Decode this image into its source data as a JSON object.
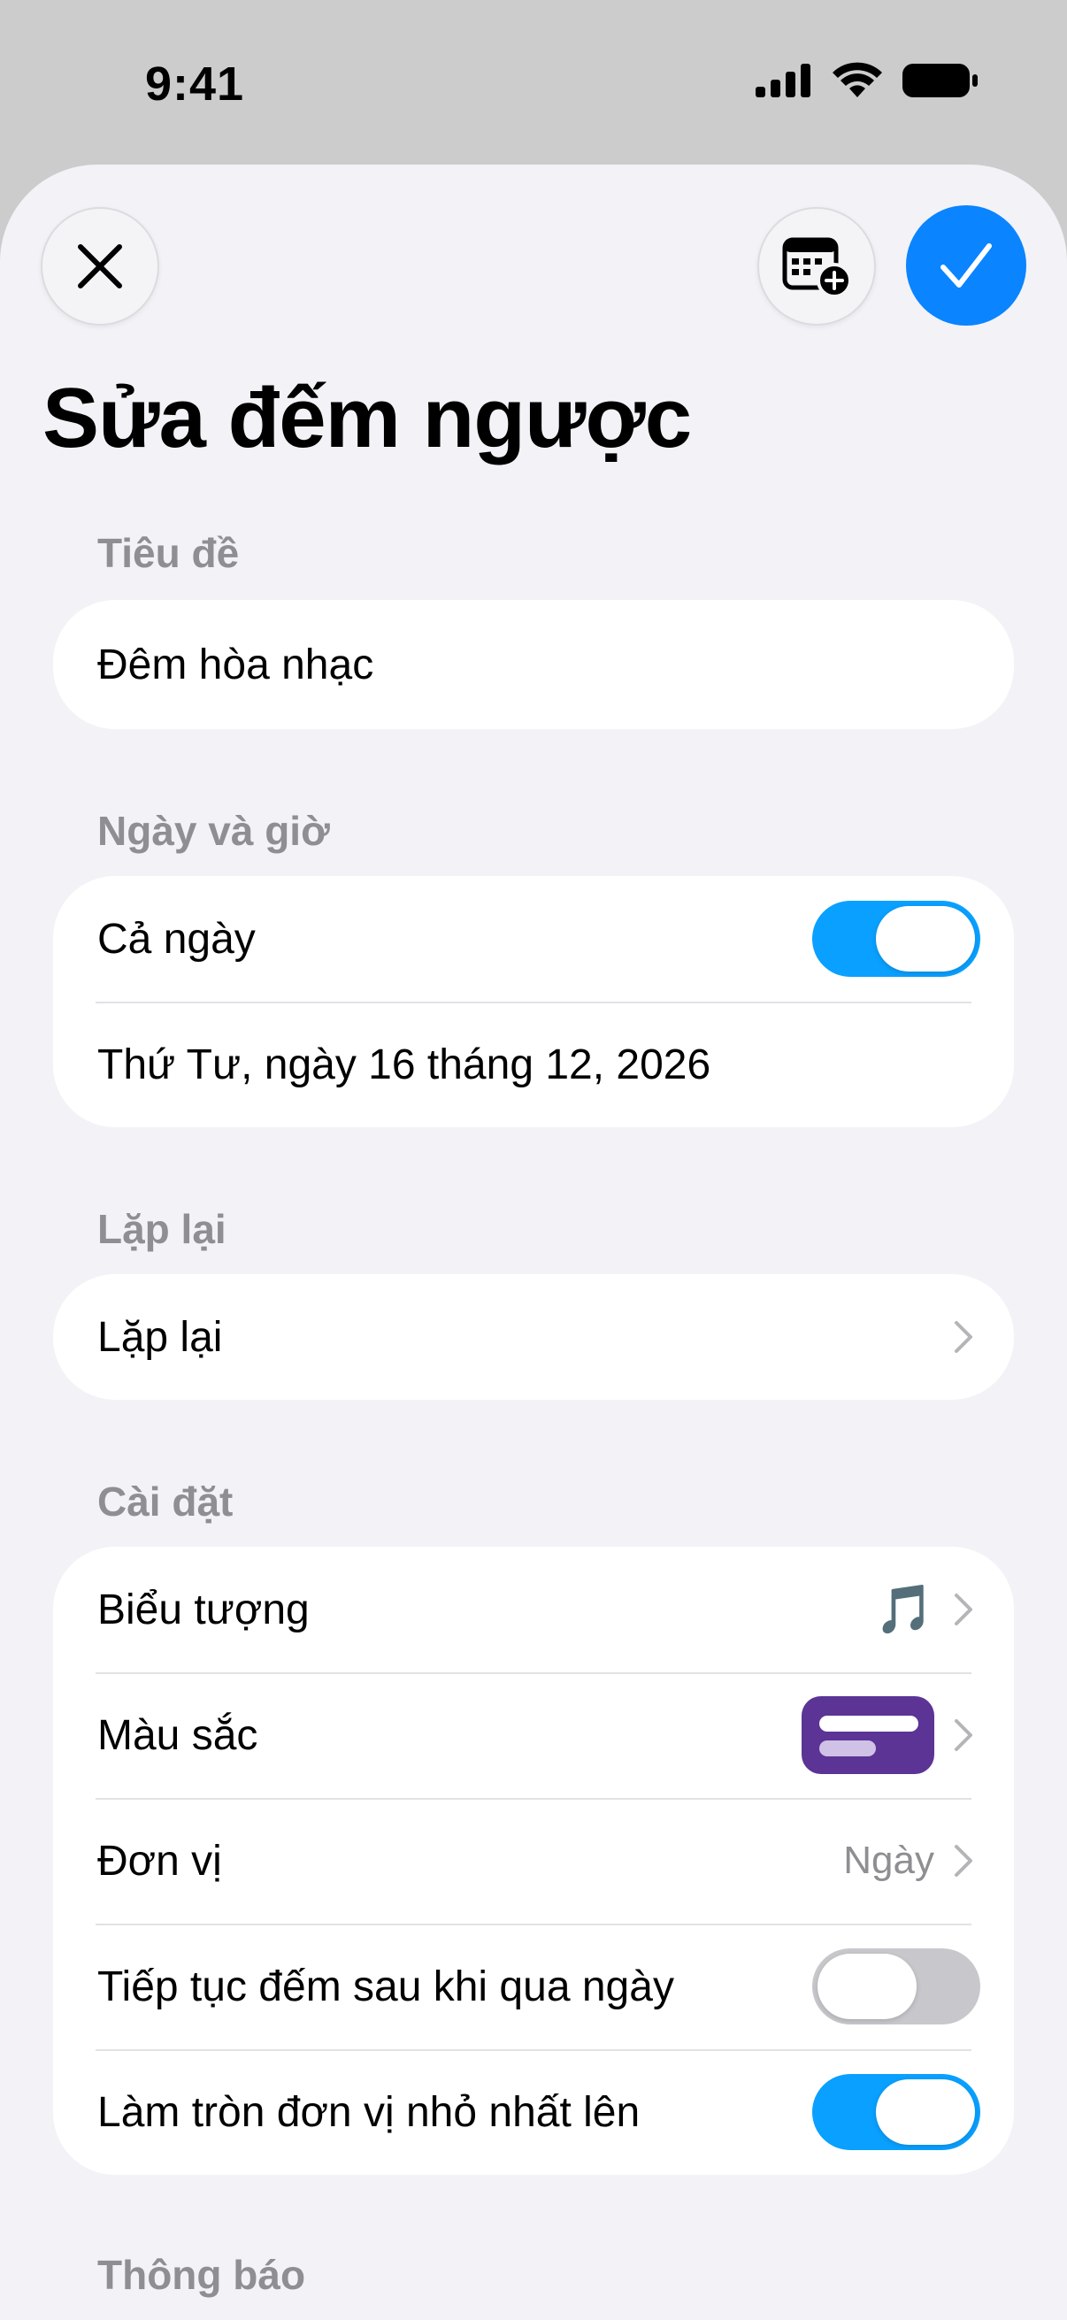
{
  "status_bar": {
    "time": "9:41"
  },
  "header": {
    "title": "Sửa đếm ngược"
  },
  "sections": {
    "title": {
      "label": "Tiêu đề",
      "value": "Đêm hòa nhạc"
    },
    "datetime": {
      "label": "Ngày và giờ",
      "all_day_label": "Cả ngày",
      "all_day_on": true,
      "date_text": "Thứ Tư, ngày 16 tháng 12, 2026"
    },
    "repeat": {
      "label": "Lặp lại",
      "row_label": "Lặp lại"
    },
    "settings": {
      "label": "Cài đặt",
      "icon_label": "Biểu tượng",
      "icon_value": "music-note-icon",
      "color_label": "Màu sắc",
      "color_value": "#5b3496",
      "unit_label": "Đơn vị",
      "unit_value": "Ngày",
      "continue_label": "Tiếp tục đếm sau khi qua ngày",
      "continue_on": false,
      "round_label": "Làm tròn đơn vị nhỏ nhất lên",
      "round_on": true
    },
    "notifications": {
      "label": "Thông báo"
    }
  },
  "colors": {
    "accent": "#0a84ff",
    "toggle_on": "#0aa0ff",
    "toggle_off": "#c8c8cc",
    "background": "#f2f2f7"
  }
}
